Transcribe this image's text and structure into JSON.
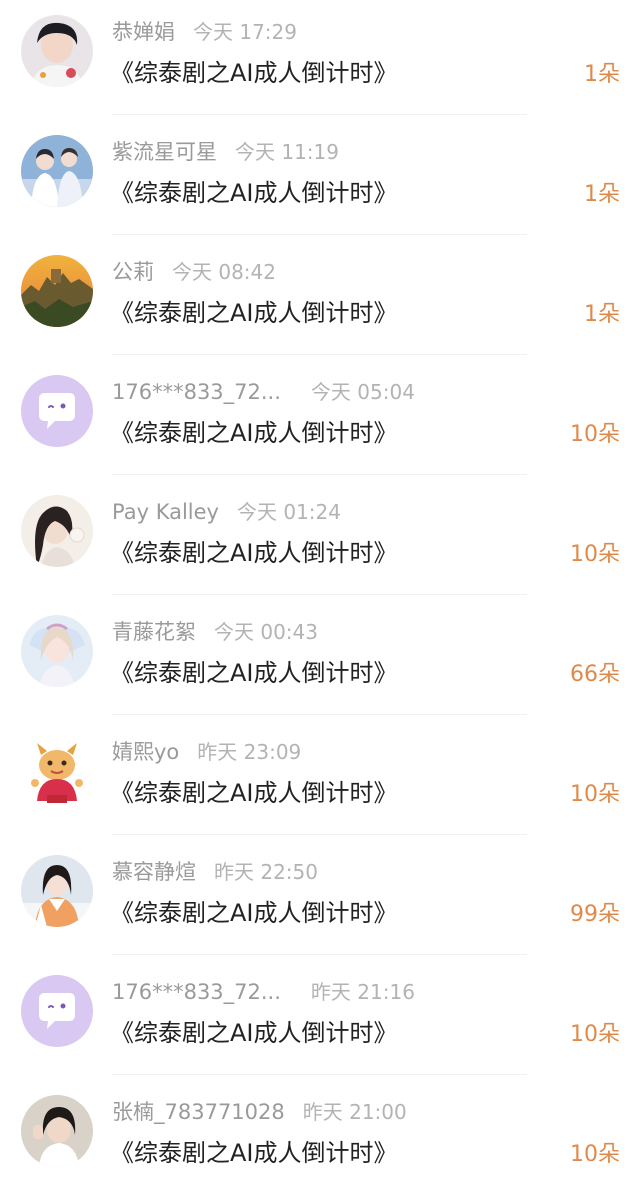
{
  "accent_color": "#e08a4a",
  "items": [
    {
      "name": "恭婵娟",
      "time": "今天 17:29",
      "title": "《综泰剧之AI成人倒计时》",
      "count": "1朵",
      "avatar": "photo-avatar"
    },
    {
      "name": "紫流星可星",
      "time": "今天 11:19",
      "title": "《综泰剧之AI成人倒计时》",
      "count": "1朵",
      "avatar": "photo-avatar"
    },
    {
      "name": "公莉",
      "time": "今天 08:42",
      "title": "《综泰剧之AI成人倒计时》",
      "count": "1朵",
      "avatar": "landscape-avatar"
    },
    {
      "name": "176***833_72...",
      "time": "今天 05:04",
      "title": "《综泰剧之AI成人倒计时》",
      "count": "10朵",
      "avatar": "chat-bubble-icon"
    },
    {
      "name": "Pay Kalley",
      "time": "今天 01:24",
      "title": "《综泰剧之AI成人倒计时》",
      "count": "10朵",
      "avatar": "photo-avatar"
    },
    {
      "name": "青藤花絮",
      "time": "今天 00:43",
      "title": "《综泰剧之AI成人倒计时》",
      "count": "66朵",
      "avatar": "photo-avatar"
    },
    {
      "name": "婧熙yo",
      "time": "昨天 23:09",
      "title": "《综泰剧之AI成人倒计时》",
      "count": "10朵",
      "avatar": "dragon-cartoon-avatar"
    },
    {
      "name": "慕容静煊",
      "time": "昨天 22:50",
      "title": "《综泰剧之AI成人倒计时》",
      "count": "99朵",
      "avatar": "photo-avatar"
    },
    {
      "name": "176***833_72...",
      "time": "昨天 21:16",
      "title": "《综泰剧之AI成人倒计时》",
      "count": "10朵",
      "avatar": "chat-bubble-icon"
    },
    {
      "name": "张楠_783771028",
      "time": "昨天 21:00",
      "title": "《综泰剧之AI成人倒计时》",
      "count": "10朵",
      "avatar": "photo-avatar"
    }
  ]
}
